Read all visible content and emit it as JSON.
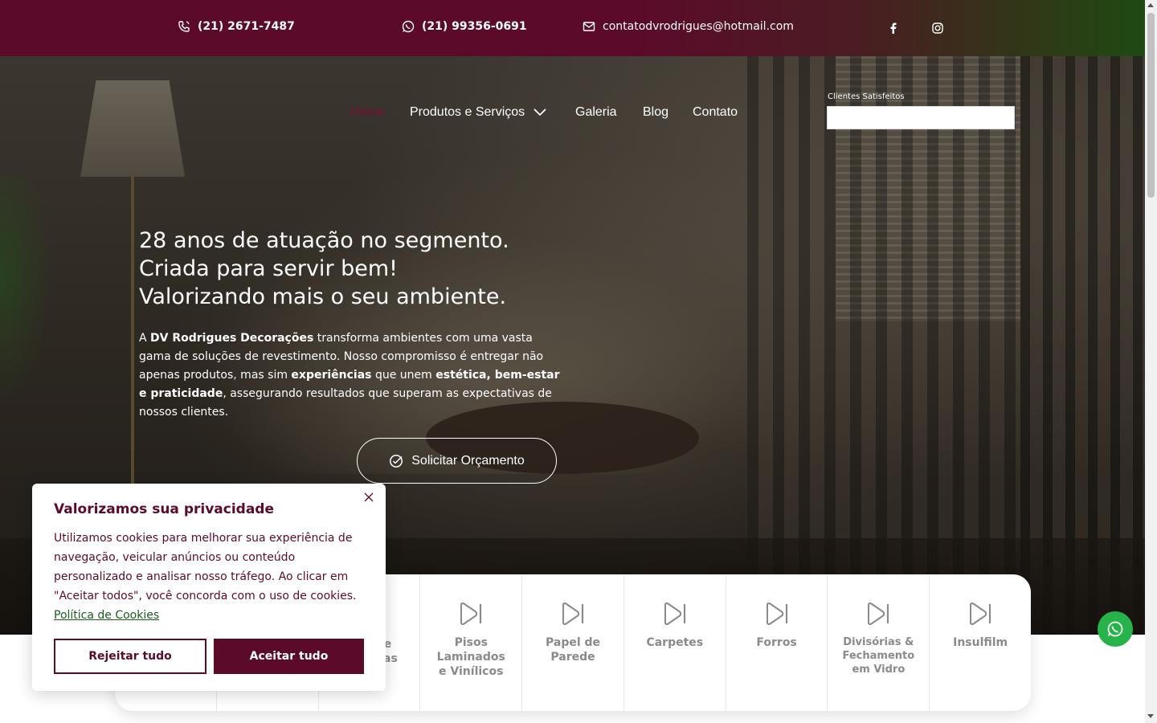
{
  "topbar": {
    "phone": "(21) 2671-7487",
    "whatsapp": "(21) 99356-0691",
    "email": "contatodvrodrigues@hotmail.com",
    "social": [
      "facebook-icon",
      "instagram-icon"
    ]
  },
  "nav": {
    "items": [
      "Home",
      "Produtos e Serviços",
      "Galeria",
      "Blog",
      "Contato"
    ],
    "active": "Home"
  },
  "clients_widget": {
    "label": "Clientes Satisfeitos"
  },
  "hero": {
    "title_line1": "28 anos de atuação no segmento.",
    "title_line2": "Criada para servir bem!",
    "title_line3": "Valorizando mais o seu ambiente.",
    "text_a": "A ",
    "text_brand": "DV Rodrigues Decorações",
    "text_b": " transforma ambientes com uma vasta gama de soluções de revestimento. Nosso compromisso é entregar não apenas produtos, mas sim ",
    "text_exp": "experiências",
    "text_c": " que unem ",
    "text_benefits": "estética, bem-estar e praticidade",
    "text_d": ", assegurando resultados que superam as expectativas de nossos clientes.",
    "cta": "Solicitar Orçamento"
  },
  "services": [
    {
      "label": ""
    },
    {
      "label": ""
    },
    {
      "label": "e\nras"
    },
    {
      "label": "Pisos\nLaminados\ne Vinílicos"
    },
    {
      "label": "Papel de\nParede"
    },
    {
      "label": "Carpetes"
    },
    {
      "label": "Forros"
    },
    {
      "label": "Divisórias &\nFechamento\nem Vidro"
    },
    {
      "label": "Insulfilm"
    }
  ],
  "cookie": {
    "title": "Valorizamos sua privacidade",
    "body": "Utilizamos cookies para melhorar sua experiência de navegação, veicular anúncios ou conteúdo personalizado e analisar nosso tráfego. Ao clicar em \"Aceitar todos\", você concorda com o uso de cookies. ",
    "policy_link": "Política de Cookies",
    "reject": "Rejeitar tudo",
    "accept": "Aceitar tudo"
  },
  "colors": {
    "brand": "#5c0a2a",
    "accent_green": "#1f4a12",
    "whatsapp": "#25b34a"
  }
}
